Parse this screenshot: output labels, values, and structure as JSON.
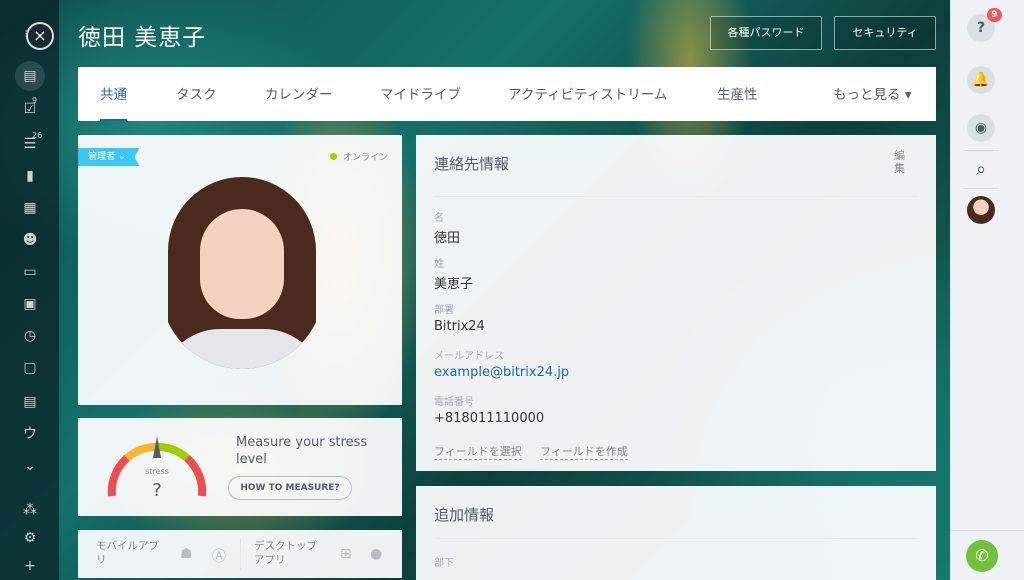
{
  "header": {
    "title": "徳田 美恵子",
    "buttons": [
      "各種パスワード",
      "セキュリティ"
    ]
  },
  "tabs": [
    {
      "label": "共通",
      "active": true
    },
    {
      "label": "タスク"
    },
    {
      "label": "カレンダー"
    },
    {
      "label": "マイドライブ"
    },
    {
      "label": "アクティビティストリーム"
    },
    {
      "label": "生産性"
    },
    {
      "label": "もっと見る ▾"
    }
  ],
  "left_sidebar": {
    "close_icon": "×",
    "items": [
      {
        "icon": "feed-icon",
        "glyph": "▤"
      },
      {
        "icon": "tasks-icon",
        "glyph": "☑",
        "badge": "9"
      },
      {
        "icon": "filter-icon",
        "glyph": "☰",
        "badge": "26"
      },
      {
        "icon": "chat-icon",
        "glyph": "▮"
      },
      {
        "icon": "apps-grid-icon",
        "glyph": "▦"
      },
      {
        "icon": "group-icon",
        "glyph": "☻"
      },
      {
        "icon": "drive-icon",
        "glyph": "▭"
      },
      {
        "icon": "calendar-icon",
        "glyph": "▣"
      },
      {
        "icon": "clock-icon",
        "glyph": "◷"
      },
      {
        "icon": "window-icon",
        "glyph": "▢"
      },
      {
        "icon": "contact-card-icon",
        "glyph": "▤"
      },
      {
        "icon": "text-glyph",
        "glyph": "ウ"
      },
      {
        "icon": "expand-down-icon",
        "glyph": "⌄"
      },
      {
        "icon": "network-icon",
        "glyph": "⁂"
      },
      {
        "icon": "gear-icon",
        "glyph": "⚙"
      },
      {
        "icon": "plus-icon",
        "glyph": "+"
      }
    ]
  },
  "right_sidebar": {
    "help_glyph": "?",
    "help_badge": "9",
    "bell_glyph": "🔔",
    "chat_glyph": "◉",
    "search_glyph": "⌕",
    "phone_glyph": "✆"
  },
  "profile": {
    "role_tag": "管理者 ⌄",
    "status": "オンライン"
  },
  "stress": {
    "label": "stress",
    "value": "?",
    "title": "Measure your stress level",
    "button": "HOW TO MEASURE?"
  },
  "apps": {
    "mobile_label": "モバイルアプリ",
    "desktop_label": "デスクトップアプリ"
  },
  "contact": {
    "title": "連絡先情報",
    "edit": "編集",
    "fields": [
      {
        "label": "名",
        "value": "徳田"
      },
      {
        "label": "姓",
        "value": "美恵子"
      },
      {
        "label": "部署",
        "value": "Bitrix24"
      },
      {
        "label": "メールアドレス",
        "value": "example@bitrix24.jp",
        "link": true
      },
      {
        "label": "電話番号",
        "value": "+818011110000"
      }
    ],
    "actions": [
      "フィールドを選択",
      "フィールドを作成"
    ]
  },
  "extra": {
    "title": "追加情報",
    "field_label": "部下"
  },
  "colors": {
    "accent": "#2067b0",
    "role_tag": "#3bc8f5",
    "online": "#9dcf00",
    "call": "#72c03d",
    "badge": "#f2555a"
  }
}
